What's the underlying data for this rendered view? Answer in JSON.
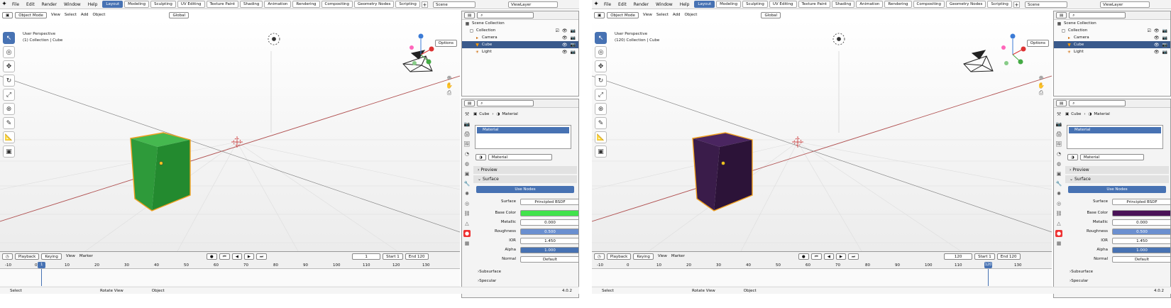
{
  "menus": [
    "File",
    "Edit",
    "Render",
    "Window",
    "Help"
  ],
  "workspaces": [
    "Layout",
    "Modeling",
    "Sculpting",
    "UV Editing",
    "Texture Paint",
    "Shading",
    "Animation",
    "Rendering",
    "Compositing",
    "Geometry Nodes",
    "Scripting"
  ],
  "scene_label": "Scene",
  "view_layer_label": "ViewLayer",
  "viewport_header": {
    "mode": "Object Mode",
    "menus": [
      "View",
      "Select",
      "Add",
      "Object"
    ],
    "orientation": "Global"
  },
  "viewport": {
    "perspective": "User Perspective",
    "options": "Options"
  },
  "outliner": {
    "root": "Scene Collection",
    "collection": "Collection",
    "items": [
      "Camera",
      "Cube",
      "Light"
    ]
  },
  "properties": {
    "breadcrumb_object": "Cube",
    "breadcrumb_data": "Material",
    "slot_name": "Material",
    "material_name": "Material",
    "panels": {
      "preview": "Preview",
      "surface": "Surface",
      "subsurface": "Subsurface",
      "specular": "Specular"
    },
    "use_nodes": "Use Nodes",
    "labels": {
      "surface": "Surface",
      "base_color": "Base Color",
      "metallic": "Metallic",
      "roughness": "Roughness",
      "ior": "IOR",
      "alpha": "Alpha",
      "normal": "Normal"
    },
    "values": {
      "surface": "Principled BSDF",
      "metallic": "0.000",
      "roughness": "0.500",
      "ior": "1.450",
      "alpha": "1.000",
      "normal": "Default"
    }
  },
  "timeline": {
    "menus": [
      "Playback",
      "Keying",
      "View",
      "Marker"
    ],
    "start_label": "Start",
    "end_label": "End",
    "start": "1",
    "end": "120",
    "ruler": [
      "-10",
      "0",
      "10",
      "20",
      "30",
      "40",
      "50",
      "60",
      "70",
      "80",
      "90",
      "100",
      "110",
      "120",
      "130"
    ]
  },
  "statusbar": {
    "select": "Select",
    "rotate": "Rotate View",
    "object": "Object",
    "version": "4.0.2"
  },
  "instances": [
    {
      "frame": "1",
      "collection_path": "(1) Collection | Cube",
      "cube_color": "#2e9a3a",
      "cube_top": "#45b84f",
      "cube_side": "#238a2f",
      "base_color": "#41e34c",
      "slot_color": "#4772b3"
    },
    {
      "frame": "120",
      "collection_path": "(120) Collection | Cube",
      "cube_color": "#3a1c4a",
      "cube_top": "#4a2560",
      "cube_side": "#2c1338",
      "base_color": "#4a1257",
      "slot_color": "#4772b3"
    }
  ]
}
